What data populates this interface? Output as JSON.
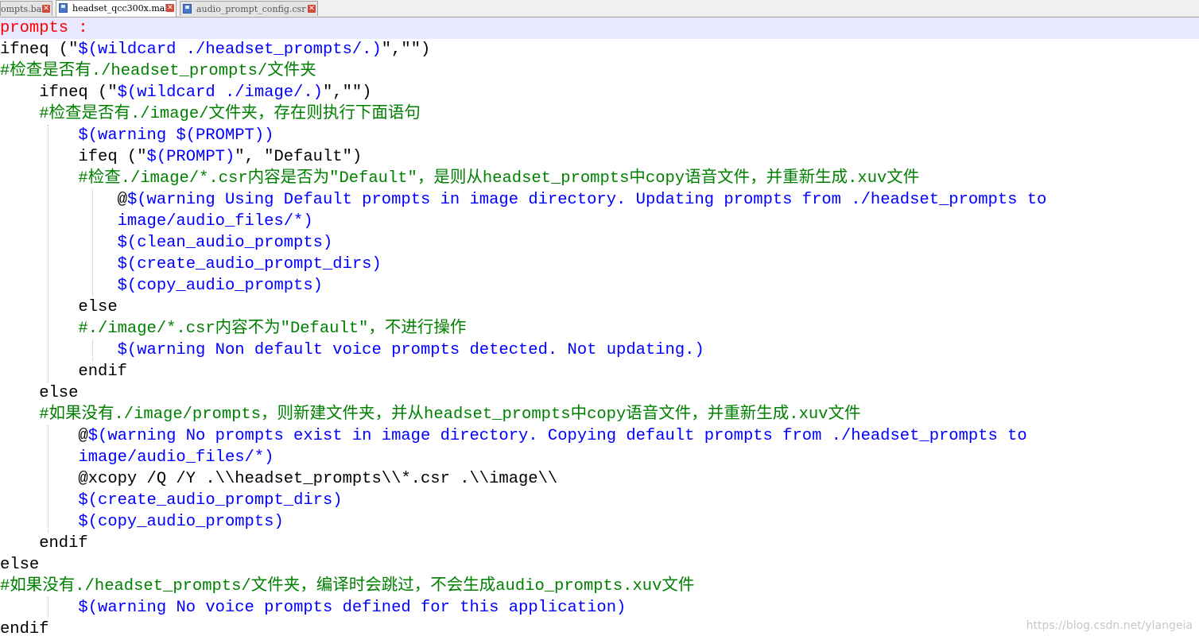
{
  "tabs": [
    {
      "label": "ompts.bat",
      "active": false
    },
    {
      "label": "headset_qcc300x.mak",
      "active": true
    },
    {
      "label": "audio_prompt_config.csr",
      "active": false
    }
  ],
  "code_lines": [
    [
      {
        "t": "prompts :",
        "c": "tgt"
      }
    ],
    [
      {
        "t": "ifneq (\"",
        "c": "kw"
      },
      {
        "t": "$(wildcard ./headset_prompts/.)",
        "c": "var"
      },
      {
        "t": "\",\"\")",
        "c": "kw"
      }
    ],
    [
      {
        "t": "#检查是否有./headset_prompts/文件夹",
        "c": "cmt"
      }
    ],
    [
      {
        "t": "    ifneq (\"",
        "c": "kw"
      },
      {
        "t": "$(wildcard ./image/.)",
        "c": "var"
      },
      {
        "t": "\",\"\")",
        "c": "kw"
      }
    ],
    [
      {
        "t": "    #检查是否有./image/文件夹，存在则执行下面语句",
        "c": "cmt"
      }
    ],
    [
      {
        "t": "        ",
        "c": "kw"
      },
      {
        "t": "$(warning $(PROMPT))",
        "c": "var"
      }
    ],
    [
      {
        "t": "        ifeq (\"",
        "c": "kw"
      },
      {
        "t": "$(PROMPT)",
        "c": "var"
      },
      {
        "t": "\", \"Default\")",
        "c": "kw"
      }
    ],
    [
      {
        "t": "        #检查./image/*.csr内容是否为\"Default\"，是则从headset_prompts中copy语音文件，并重新生成.xuv文件",
        "c": "cmt"
      }
    ],
    [
      {
        "t": "            @",
        "c": "kw"
      },
      {
        "t": "$(warning Using Default prompts in image directory. Updating prompts from ./headset_prompts to",
        "c": "var"
      }
    ],
    [
      {
        "t": "            image/audio_files/*)",
        "c": "var"
      }
    ],
    [
      {
        "t": "            ",
        "c": "kw"
      },
      {
        "t": "$(clean_audio_prompts)",
        "c": "var"
      }
    ],
    [
      {
        "t": "            ",
        "c": "kw"
      },
      {
        "t": "$(create_audio_prompt_dirs)",
        "c": "var"
      }
    ],
    [
      {
        "t": "            ",
        "c": "kw"
      },
      {
        "t": "$(copy_audio_prompts)",
        "c": "var"
      }
    ],
    [
      {
        "t": "        else",
        "c": "kw"
      }
    ],
    [
      {
        "t": "        #./image/*.csr内容不为\"Default\"，不进行操作",
        "c": "cmt"
      }
    ],
    [
      {
        "t": "            ",
        "c": "kw"
      },
      {
        "t": "$(warning Non default voice prompts detected. Not updating.)",
        "c": "var"
      }
    ],
    [
      {
        "t": "        endif",
        "c": "kw"
      }
    ],
    [
      {
        "t": "    else",
        "c": "kw"
      }
    ],
    [
      {
        "t": "    #如果没有./image/prompts，则新建文件夹，并从headset_prompts中copy语音文件，并重新生成.xuv文件",
        "c": "cmt"
      }
    ],
    [
      {
        "t": "        @",
        "c": "kw"
      },
      {
        "t": "$(warning No prompts exist in image directory. Copying default prompts from ./headset_prompts to",
        "c": "var"
      }
    ],
    [
      {
        "t": "        image/audio_files/*)",
        "c": "var"
      }
    ],
    [
      {
        "t": "        @xcopy /Q /Y .\\\\headset_prompts\\\\*.csr .\\\\image\\\\",
        "c": "kw"
      }
    ],
    [
      {
        "t": "        ",
        "c": "kw"
      },
      {
        "t": "$(create_audio_prompt_dirs)",
        "c": "var"
      }
    ],
    [
      {
        "t": "        ",
        "c": "kw"
      },
      {
        "t": "$(copy_audio_prompts)",
        "c": "var"
      }
    ],
    [
      {
        "t": "    endif",
        "c": "kw"
      }
    ],
    [
      {
        "t": "else",
        "c": "kw"
      }
    ],
    [
      {
        "t": "#如果没有./headset_prompts/文件夹，编译时会跳过，不会生成audio_prompts.xuv文件",
        "c": "cmt"
      }
    ],
    [
      {
        "t": "        ",
        "c": "kw"
      },
      {
        "t": "$(warning No voice prompts defined for this application)",
        "c": "var"
      }
    ],
    [
      {
        "t": "endif",
        "c": "kw"
      }
    ]
  ],
  "watermark": "https://blog.csdn.net/ylangeia",
  "colors": {
    "comment": "#008000",
    "variable": "#0000ff",
    "target": "#ff0000",
    "current_line": "#e8e8ff"
  }
}
